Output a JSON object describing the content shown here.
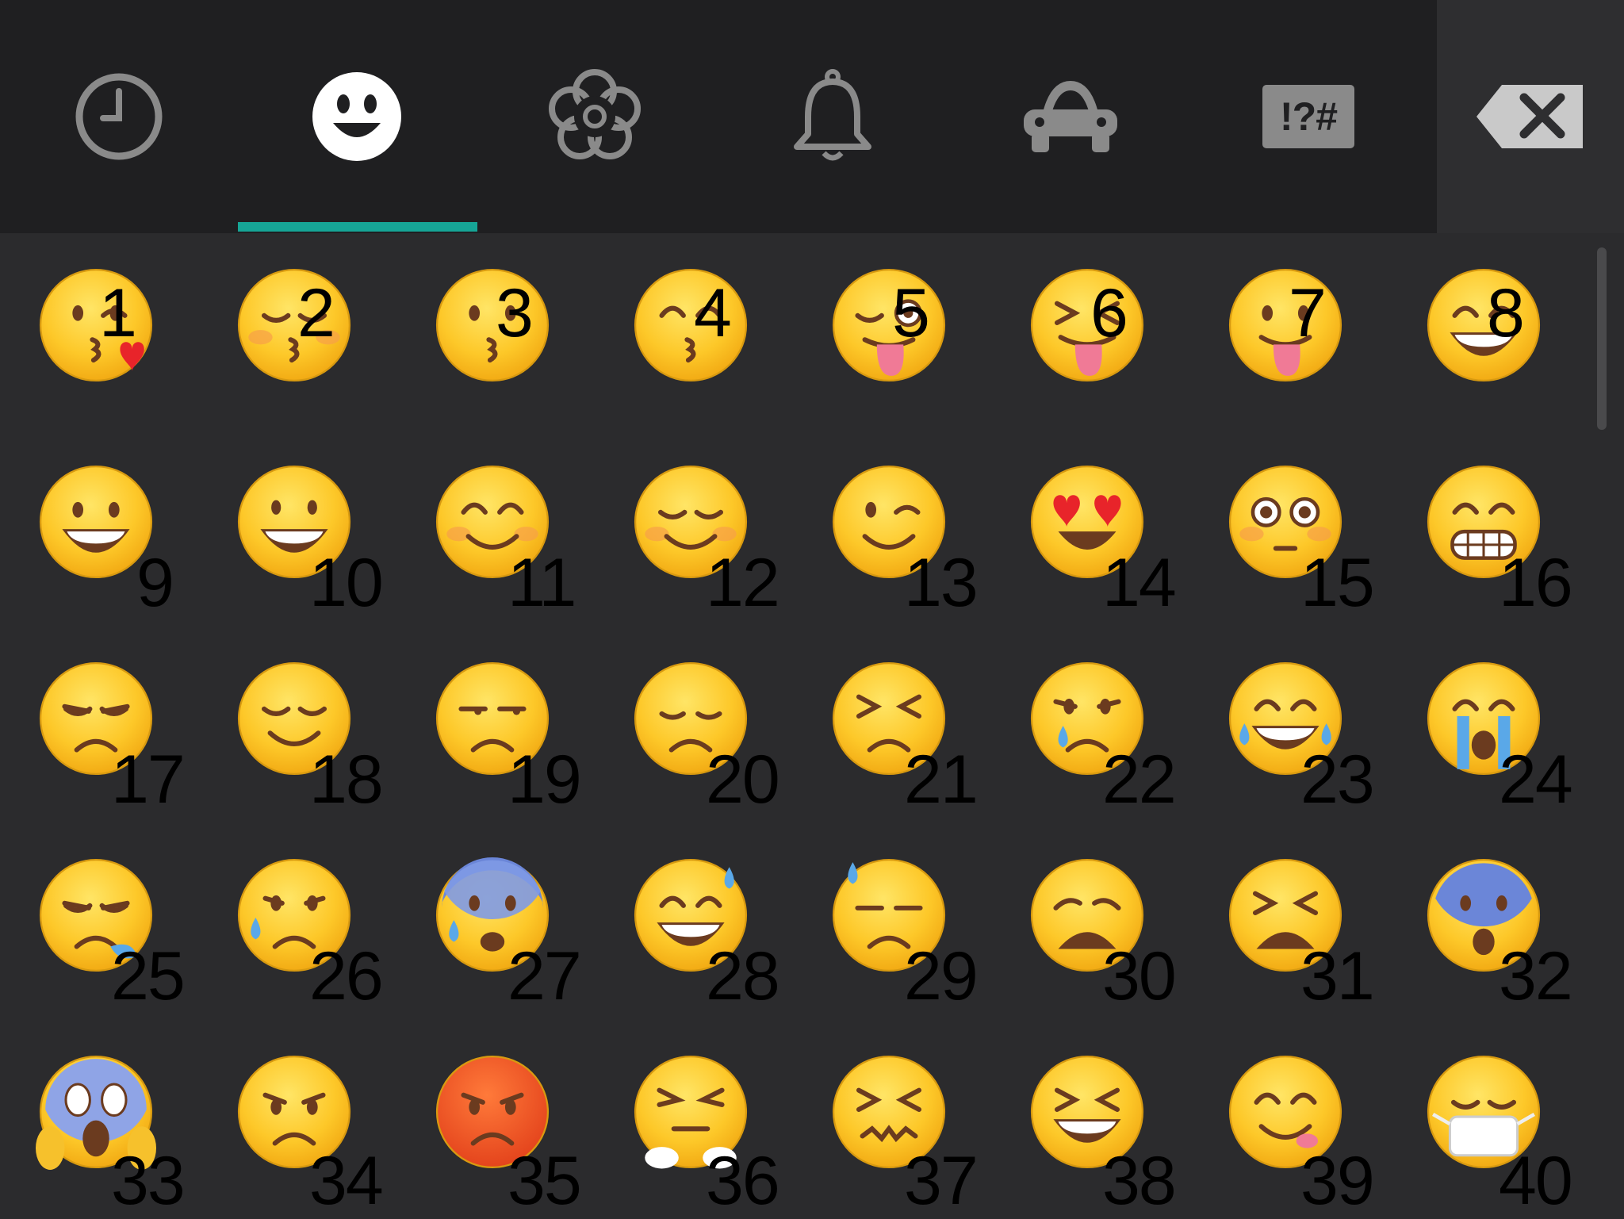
{
  "tabs": [
    {
      "name": "recent",
      "icon": "clock-icon"
    },
    {
      "name": "people",
      "icon": "smiley-icon",
      "active": true
    },
    {
      "name": "nature",
      "icon": "flower-icon"
    },
    {
      "name": "objects",
      "icon": "bell-icon"
    },
    {
      "name": "places",
      "icon": "car-icon"
    },
    {
      "name": "symbols",
      "icon": "symbols-icon",
      "label": "!?#"
    }
  ],
  "backspace": {
    "icon": "backspace-icon"
  },
  "accent_color": "#16a596",
  "emojis": [
    {
      "label": "1",
      "kind": "kiss-heart"
    },
    {
      "label": "2",
      "kind": "kiss-closed"
    },
    {
      "label": "3",
      "kind": "kiss"
    },
    {
      "label": "4",
      "kind": "kiss-smile"
    },
    {
      "label": "5",
      "kind": "tongue-wink"
    },
    {
      "label": "6",
      "kind": "tongue-squint"
    },
    {
      "label": "7",
      "kind": "tongue"
    },
    {
      "label": "8",
      "kind": "grin-smile"
    },
    {
      "label": "9",
      "kind": "smiley"
    },
    {
      "label": "10",
      "kind": "smile-open"
    },
    {
      "label": "11",
      "kind": "smile-blush"
    },
    {
      "label": "12",
      "kind": "relaxed"
    },
    {
      "label": "13",
      "kind": "wink"
    },
    {
      "label": "14",
      "kind": "heart-eyes"
    },
    {
      "label": "15",
      "kind": "flushed"
    },
    {
      "label": "16",
      "kind": "grimace"
    },
    {
      "label": "17",
      "kind": "pensive"
    },
    {
      "label": "18",
      "kind": "relieved"
    },
    {
      "label": "19",
      "kind": "unamused"
    },
    {
      "label": "20",
      "kind": "disappointed"
    },
    {
      "label": "21",
      "kind": "persevere"
    },
    {
      "label": "22",
      "kind": "cry"
    },
    {
      "label": "23",
      "kind": "joy"
    },
    {
      "label": "24",
      "kind": "sob"
    },
    {
      "label": "25",
      "kind": "sleepy"
    },
    {
      "label": "26",
      "kind": "sad-sweat"
    },
    {
      "label": "27",
      "kind": "cold-sweat"
    },
    {
      "label": "28",
      "kind": "sweat-smile"
    },
    {
      "label": "29",
      "kind": "sweat"
    },
    {
      "label": "30",
      "kind": "weary"
    },
    {
      "label": "31",
      "kind": "tired"
    },
    {
      "label": "32",
      "kind": "fearful"
    },
    {
      "label": "33",
      "kind": "scream"
    },
    {
      "label": "34",
      "kind": "angry"
    },
    {
      "label": "35",
      "kind": "rage"
    },
    {
      "label": "36",
      "kind": "triumph"
    },
    {
      "label": "37",
      "kind": "confounded"
    },
    {
      "label": "38",
      "kind": "laughing"
    },
    {
      "label": "39",
      "kind": "yum"
    },
    {
      "label": "40",
      "kind": "mask"
    }
  ]
}
